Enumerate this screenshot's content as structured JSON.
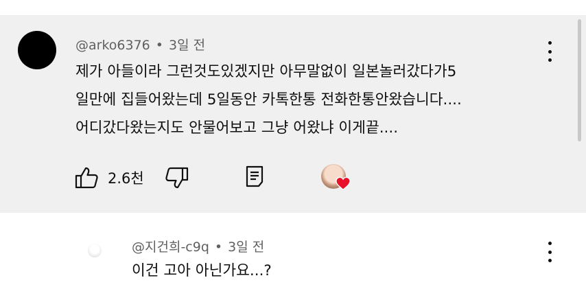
{
  "comments": [
    {
      "handle": "@arko6376",
      "separator": "•",
      "time": "3일 전",
      "lines": [
        "제가 아들이라 그런것도있겠지만 아무말없이 일본놀러갔다가5",
        "일만에 집들어왔는데 5일동안 카톡한통 전화한통안왔습니다....",
        "어디갔다왔는지도 안물어보고 그냥 어왔냐 이게끝...."
      ],
      "likes": "2.6천",
      "icons": [
        "thumbs-up-icon",
        "thumbs-down-icon",
        "reply-icon",
        "creator-heart-icon",
        "more-vert-icon"
      ]
    },
    {
      "handle": "@지건희-c9q",
      "separator": "•",
      "time": "3일 전",
      "text": "이건 고아 아닌가요...?",
      "icons": [
        "more-vert-icon"
      ]
    }
  ],
  "colors": {
    "highlight_bg": "#f0f0f0",
    "meta_text": "#606060",
    "heart": "#e8132b"
  }
}
